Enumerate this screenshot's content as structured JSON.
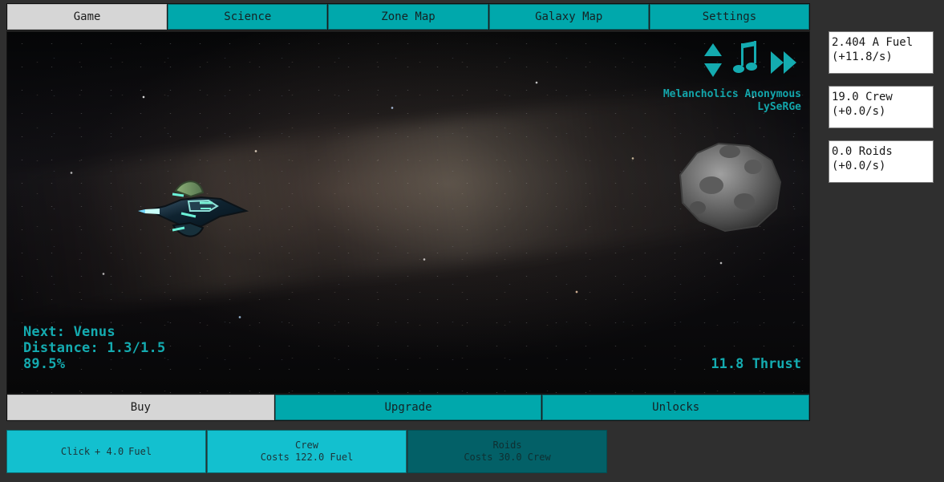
{
  "top_tabs": [
    {
      "label": "Game",
      "active": true
    },
    {
      "label": "Science",
      "active": false
    },
    {
      "label": "Zone Map",
      "active": false
    },
    {
      "label": "Galaxy Map",
      "active": false
    },
    {
      "label": "Settings",
      "active": false
    }
  ],
  "hud": {
    "song_title": "Melancholics Anonymous",
    "song_artist": "LySeRGe",
    "next_label": "Next: Venus",
    "distance_label": "Distance: 1.3/1.5",
    "progress_label": "89.5%",
    "thrust_label": "11.8 Thrust",
    "icons": {
      "volume": "volume-up-down-icon",
      "music": "music-note-icon",
      "fast_forward": "fast-forward-icon"
    },
    "colors": {
      "accent": "#14abb0"
    }
  },
  "bottom_tabs": [
    {
      "label": "Buy",
      "active": true
    },
    {
      "label": "Upgrade",
      "active": false
    },
    {
      "label": "Unlocks",
      "active": false
    }
  ],
  "purchases": [
    {
      "prefix": "Click",
      "amount": "+ 4.0",
      "suffix": "Fuel",
      "enabled": true
    },
    {
      "title": "Crew",
      "cost": "Costs 122.0 Fuel",
      "enabled": true
    },
    {
      "title": "Roids",
      "cost": "Costs 30.0 Crew",
      "enabled": false
    }
  ],
  "resources": [
    {
      "line1": "2.404 A Fuel",
      "line2": "(+11.8/s)"
    },
    {
      "line1": "19.0 Crew",
      "line2": "(+0.0/s)"
    },
    {
      "line1": "0.0 Roids",
      "line2": "(+0.0/s)"
    }
  ]
}
